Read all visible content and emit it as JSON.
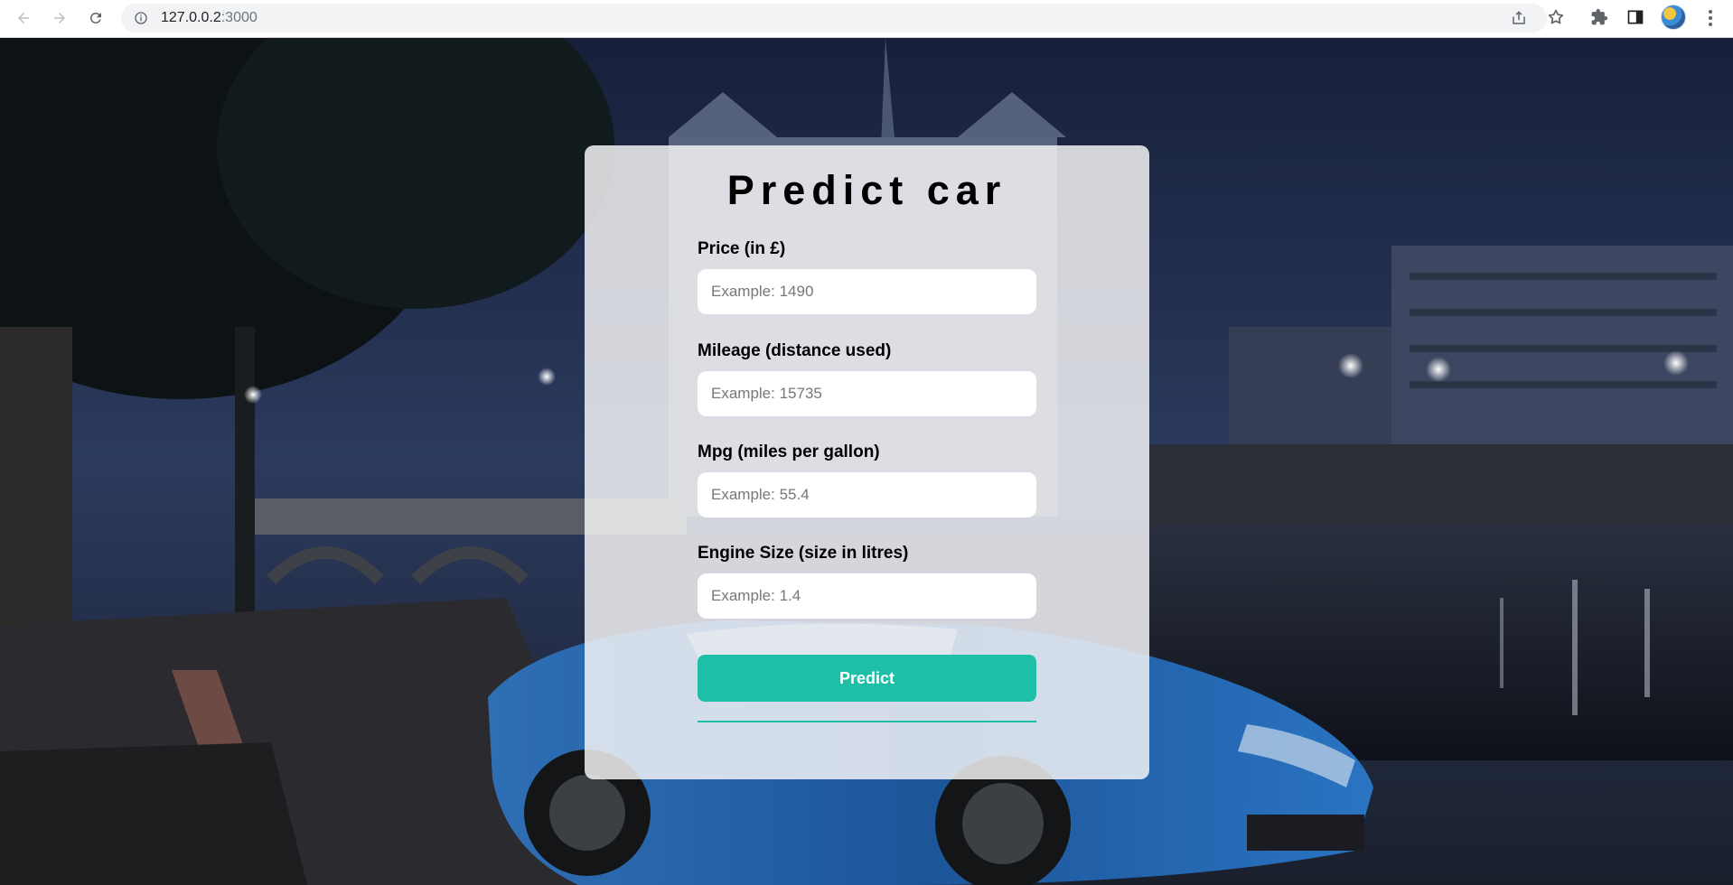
{
  "browser": {
    "url_host": "127.0.0.2",
    "url_port": ":3000"
  },
  "form": {
    "title": "Predict car",
    "fields": [
      {
        "label": "Price (in £)",
        "placeholder": "Example: 1490"
      },
      {
        "label": "Mileage (distance used)",
        "placeholder": "Example: 15735"
      },
      {
        "label": "Mpg (miles per gallon)",
        "placeholder": "Example: 55.4"
      },
      {
        "label": "Engine Size (size in litres)",
        "placeholder": "Example: 1.4"
      }
    ],
    "submit_label": "Predict",
    "accent_color": "#1fbfa7"
  },
  "icons": {
    "back": "arrow-left-icon",
    "forward": "arrow-right-icon",
    "reload": "reload-icon",
    "site_info": "info-icon",
    "share": "share-icon",
    "bookmark": "star-icon",
    "extensions": "puzzle-icon",
    "side_panel": "side-panel-icon",
    "profile": "avatar",
    "menu": "kebab-menu-icon"
  }
}
